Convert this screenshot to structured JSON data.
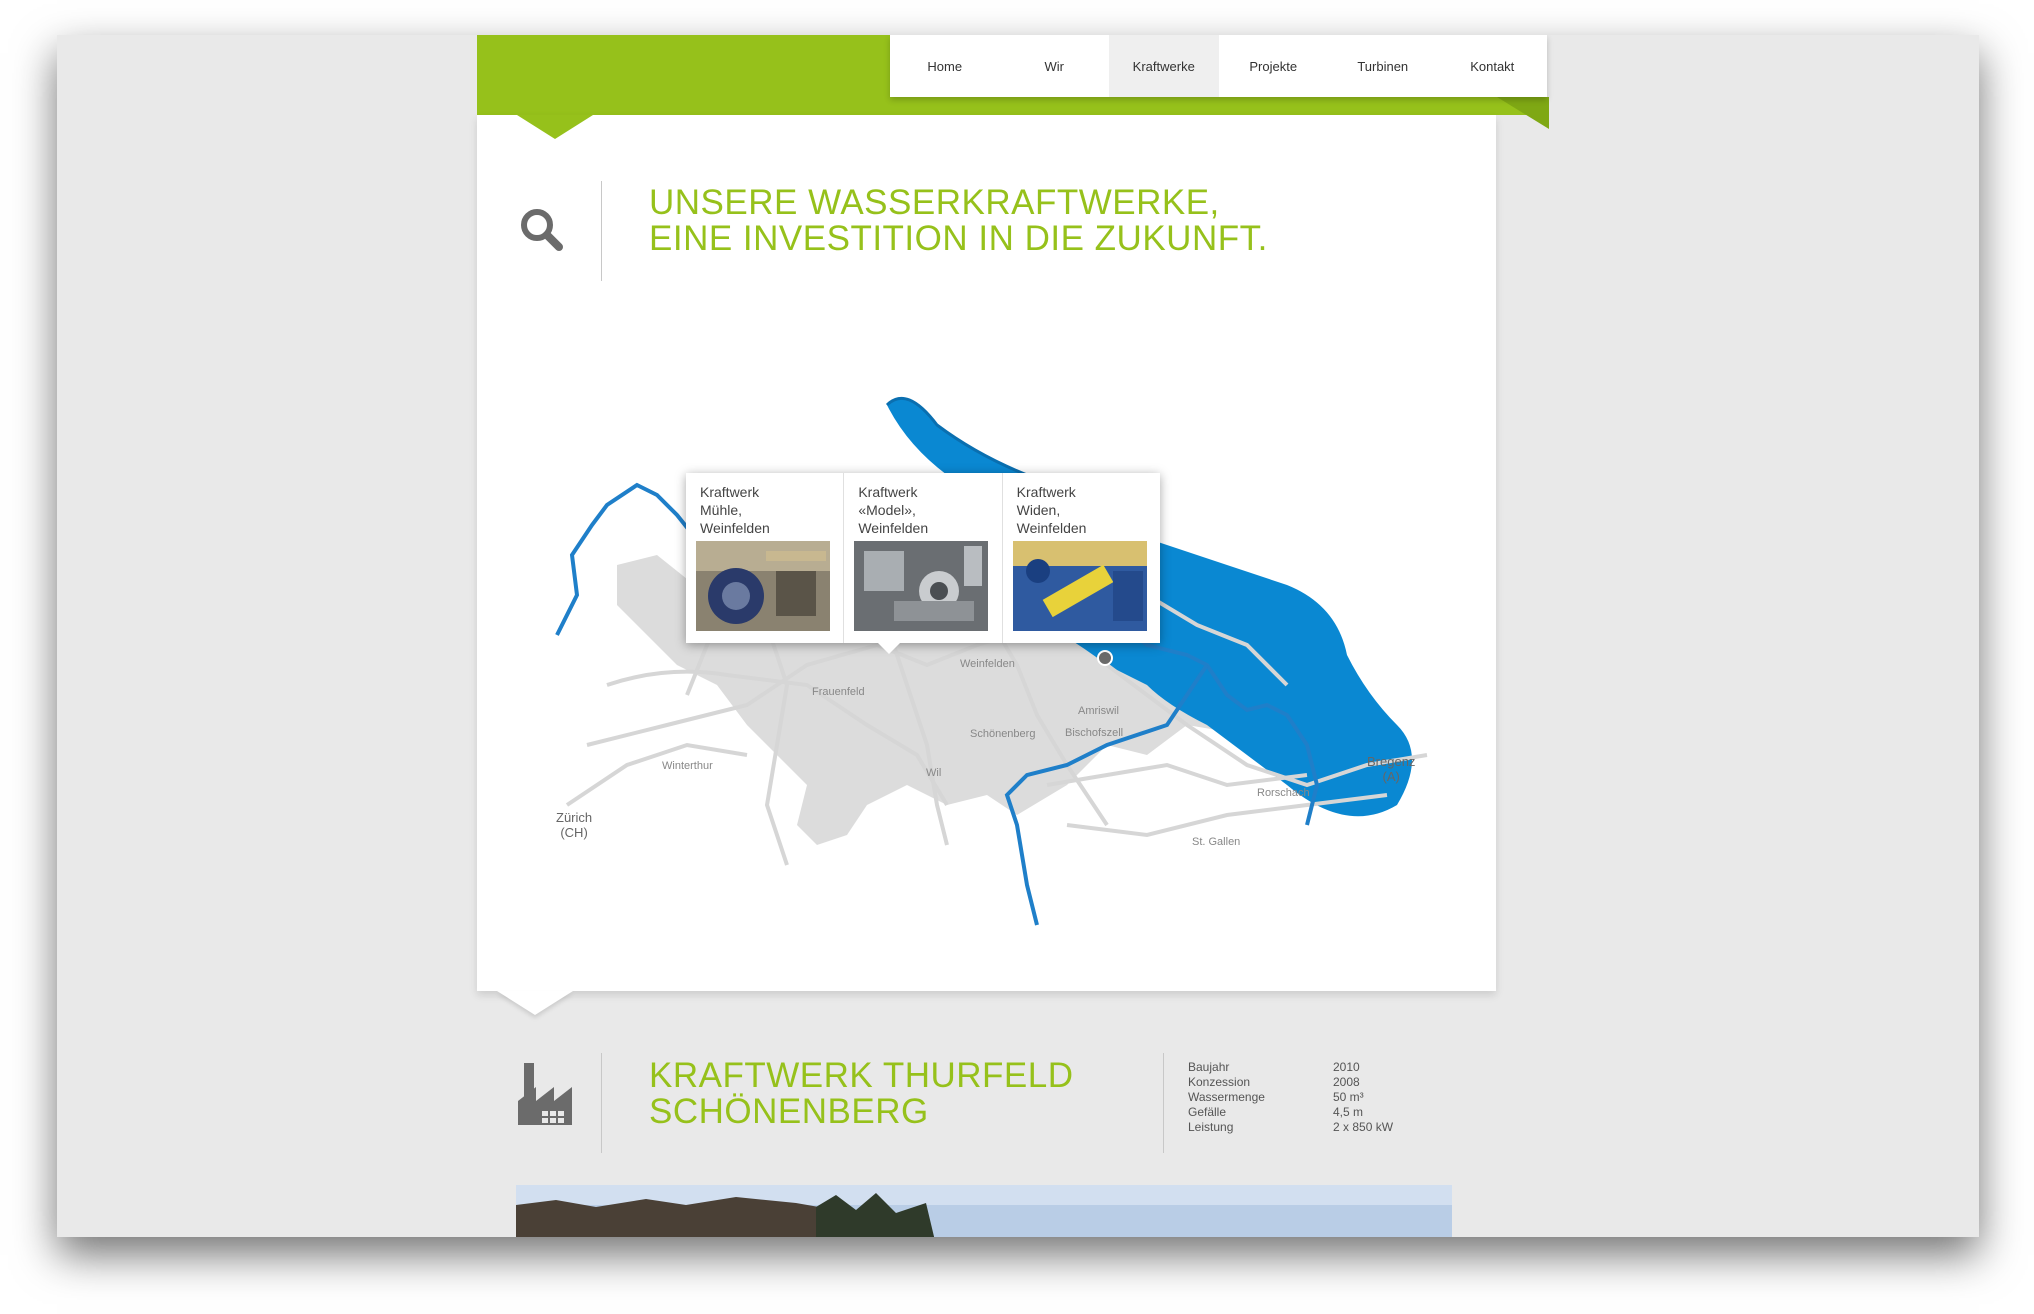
{
  "nav": {
    "items": [
      "Home",
      "Wir",
      "Kraftwerke",
      "Projekte",
      "Turbinen",
      "Kontakt"
    ],
    "active": "Kraftwerke"
  },
  "hero": {
    "title_line1": "UNSERE WASSERKRAFTWERKE,",
    "title_line2": "EINE INVESTITION IN DIE ZUKUNFT.",
    "icon": "search-icon"
  },
  "map": {
    "labels": {
      "frauenfeld": "Frauenfeld",
      "weinfelden": "Weinfelden",
      "amriswil": "Amriswil",
      "schoenenberg": "Schönenberg",
      "bischofszell": "Bischofszell",
      "winterthur": "Winterthur",
      "wil": "Wil",
      "rorschach": "Rorschach",
      "stgallen": "St. Gallen",
      "zurich": "Zürich",
      "zurich_country": "(CH)",
      "bregenz": "Bregenz",
      "bregenz_country": "(A)"
    },
    "popup": [
      {
        "lines": [
          "Kraftwerk",
          "Mühle,",
          "Weinfelden"
        ]
      },
      {
        "lines": [
          "Kraftwerk",
          "«Model»,",
          "Weinfelden"
        ]
      },
      {
        "lines": [
          "Kraftwerk",
          "Widen,",
          "Weinfelden"
        ]
      }
    ]
  },
  "plant": {
    "title_line1": "KRAFTWERK THURFELD",
    "title_line2": "SCHÖNENBERG",
    "icon": "factory-icon",
    "stats": [
      {
        "key": "Baujahr",
        "value": "2010"
      },
      {
        "key": "Konzession",
        "value": "2008"
      },
      {
        "key": "Wassermenge",
        "value": "50 m³"
      },
      {
        "key": "Gefälle",
        "value": "4,5 m"
      },
      {
        "key": "Leistung",
        "value": "2 x 850 kW"
      }
    ]
  },
  "colors": {
    "brand_green": "#96c11b",
    "water_blue": "#0a7fc8",
    "river_blue": "#1f7fc9",
    "road_gray": "#d8d8d8",
    "window_bg": "#e9e9e9"
  }
}
